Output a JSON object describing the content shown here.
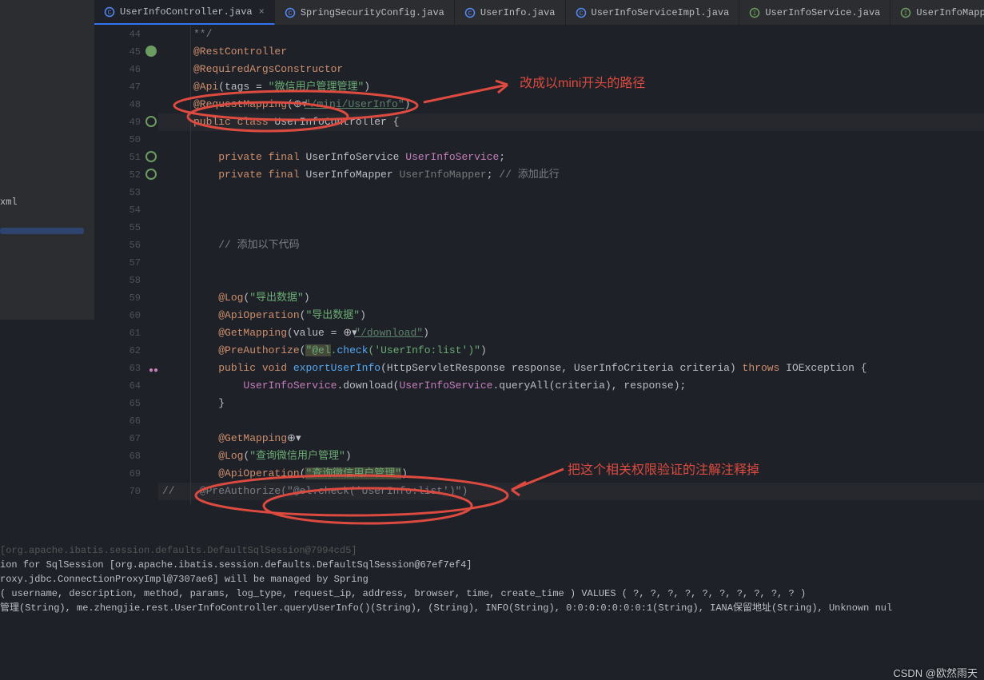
{
  "tabs": [
    {
      "label": "UserInfoController.java",
      "active": true,
      "icon": "c"
    },
    {
      "label": "SpringSecurityConfig.java",
      "active": false,
      "icon": "c"
    },
    {
      "label": "UserInfo.java",
      "active": false,
      "icon": "c"
    },
    {
      "label": "UserInfoServiceImpl.java",
      "active": false,
      "icon": "c"
    },
    {
      "label": "UserInfoService.java",
      "active": false,
      "icon": "i"
    },
    {
      "label": "UserInfoMappe",
      "active": false,
      "icon": "i"
    }
  ],
  "tree": {
    "file": "xml"
  },
  "annot": {
    "label1": "改成以mini开头的路径",
    "label2": "把这个相关权限验证的注解注释掉"
  },
  "lines_start": 44,
  "code": {
    "l44": "**/",
    "l45_a": "@RestController",
    "l46_a": "@RequiredArgsConstructor",
    "l47_a": "@Api",
    "l47_p": "(tags = ",
    "l47_s": "\"微信用户管理管理\"",
    "l47_e": ")",
    "l48_a": "@RequestMapping",
    "l48_p": "(",
    "l48_s": "\"/mini/UserInfo\"",
    "l48_e": ")",
    "l49_k": "public class ",
    "l49_t": "UserInfoController ",
    "l49_b": "{",
    "l51_k": "private final ",
    "l51_t": "UserInfoService ",
    "l51_f": "UserInfoService",
    "l51_e": ";",
    "l52_k": "private final ",
    "l52_t": "UserInfoMapper ",
    "l52_f": "UserInfoMapper",
    "l52_e": "; ",
    "l52_c": "// 添加此行",
    "l56_c": "// 添加以下代码",
    "l59_a": "@Log",
    "l59_p": "(",
    "l59_s": "\"导出数据\"",
    "l59_e": ")",
    "l60_a": "@ApiOperation",
    "l60_p": "(",
    "l60_s": "\"导出数据\"",
    "l60_e": ")",
    "l61_a": "@GetMapping",
    "l61_p": "(value = ",
    "l61_s": "\"/download\"",
    "l61_e": ")",
    "l62_a": "@PreAuthorize",
    "l62_p": "(",
    "l62_s": "\"@el.check('UserInfo:list')\"",
    "l62_e": ")",
    "l63_k": "public ",
    "l63_v": "void ",
    "l63_m": "exportUserInfo",
    "l63_p": "(HttpServletResponse response, UserInfoCriteria criteria) ",
    "l63_t": "throws ",
    "l63_ex": "IOException {",
    "l64_f": "UserInfoService",
    "l64_d": ".download(",
    "l64_f2": "UserInfoService",
    "l64_p": ".queryAll(criteria), response);",
    "l65": "}",
    "l67_a": "@GetMapping",
    "l68_a": "@Log",
    "l68_p": "(",
    "l68_s": "\"查询微信用户管理\"",
    "l68_e": ")",
    "l69_a": "@ApiOperation",
    "l69_p": "(",
    "l69_s": "\"查询微信用户管理\"",
    "l69_e": ")",
    "l70_c": "//    @PreAuthorize(\"@el.check('UserInfo:list')\")"
  },
  "console": {
    "l0": "[org.apache.ibatis.session.defaults.DefaultSqlSession@7994cd5]",
    "l1": "",
    "l2": "ion for SqlSession [org.apache.ibatis.session.defaults.DefaultSqlSession@67ef7ef4]",
    "l3": "roxy.jdbc.ConnectionProxyImpl@7307ae6] will be managed by Spring",
    "l4": "( username, description, method, params, log_type, request_ip, address, browser, time, create_time ) VALUES ( ?, ?, ?, ?, ?, ?, ?, ?, ?, ? )",
    "l5": "管理(String), me.zhengjie.rest.UserInfoController.queryUserInfo()(String), (String), INFO(String), 0:0:0:0:0:0:0:1(String), IANA保留地址(String), Unknown nul"
  },
  "watermark": "CSDN @欧然雨天"
}
